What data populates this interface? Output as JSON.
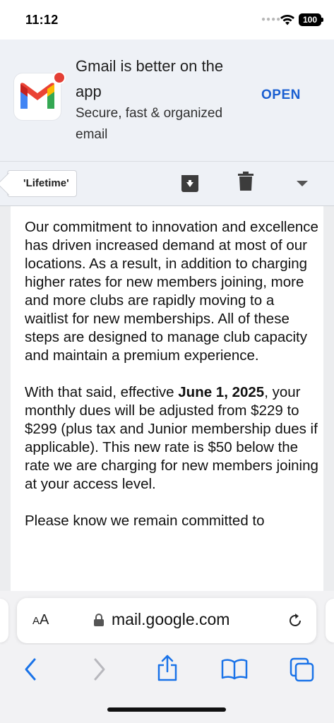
{
  "status_bar": {
    "time": "11:12",
    "battery": "100",
    "icons": [
      "cellular-dots-icon",
      "wifi-icon",
      "battery-icon"
    ]
  },
  "app_banner": {
    "title": "Gmail is better on the app",
    "subtitle": "Secure, fast & organized email",
    "open_label": "OPEN",
    "logo": "gmail-logo-icon",
    "accent": "#1a5fd1"
  },
  "toolbar": {
    "label_chip": "'Lifetime'",
    "icons": [
      "archive-icon",
      "trash-icon",
      "chevron-down-icon"
    ]
  },
  "email": {
    "para1": "Our commitment to innovation and excellence has driven increased demand at most of our locations. As a result, in addition to charging higher rates for new members joining, more and more clubs are rapidly moving to a waitlist for new memberships. All of these steps are designed to manage club capacity and maintain a premium experience.",
    "para2_before": "With that said, effective ",
    "para2_bold": "June 1, 2025",
    "para2_after": ", your monthly dues will be adjusted from $229 to $299 (plus tax and Junior membership dues if applicable). This new rate is $50 below the rate we are charging for new members joining at your access level.",
    "para3": "Please know we remain committed to"
  },
  "browser": {
    "text_size_label_small": "A",
    "text_size_label_large": "A",
    "url": "mail.google.com",
    "icons": [
      "lock-icon",
      "reload-icon",
      "back-icon",
      "forward-icon",
      "share-icon",
      "bookmarks-icon",
      "tabs-icon"
    ]
  },
  "colors": {
    "banner_bg": "#eef1f6",
    "safari_blue": "#1a73e8",
    "gmail_red": "#ea4335",
    "gmail_blue": "#4285f4",
    "gmail_green": "#34a853",
    "gmail_yellow": "#fbbc04"
  }
}
